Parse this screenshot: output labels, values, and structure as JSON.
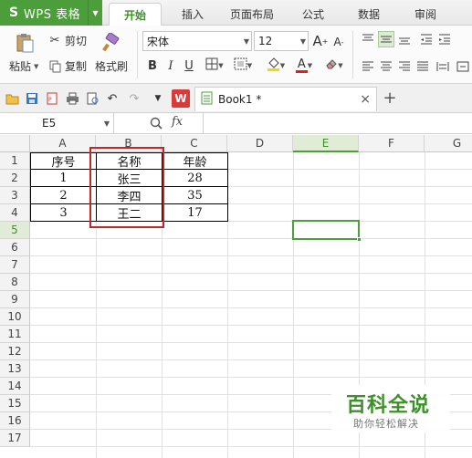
{
  "app": {
    "title": "WPS 表格",
    "logo": "S"
  },
  "tabs": [
    "开始",
    "插入",
    "页面布局",
    "公式",
    "数据",
    "审阅"
  ],
  "active_tab": "开始",
  "ribbon": {
    "paste": "粘贴",
    "cut": "剪切",
    "copy": "复制",
    "format_painter": "格式刷",
    "font_name": "宋体",
    "font_size": "12",
    "bold": "B",
    "italic": "I",
    "underline": "U",
    "font_color_letter": "A",
    "grow_font": "A",
    "shrink_font": "A"
  },
  "document_tab": {
    "title": "Book1 *",
    "close": "×",
    "new_tab": "+"
  },
  "formula_bar": {
    "name_box": "E5",
    "fx": "fx"
  },
  "columns": [
    "A",
    "B",
    "C",
    "D",
    "E",
    "F",
    "G"
  ],
  "rows": [
    "1",
    "2",
    "3",
    "4",
    "5",
    "6",
    "7",
    "8",
    "9",
    "10",
    "11",
    "12",
    "13",
    "14",
    "15",
    "16",
    "17"
  ],
  "selected_cell": "E5",
  "cells": {
    "a1": "序号",
    "b1": "名称",
    "c1": "年龄",
    "a2": "1",
    "b2": "张三",
    "c2": "28",
    "a3": "2",
    "b3": "李四",
    "c3": "35",
    "a4": "3",
    "b4": "王二",
    "c4": "17"
  },
  "watermark": {
    "title": "百科全说",
    "subtitle": "助你轻松解决"
  },
  "colors": {
    "accent": "#4b9e3a",
    "highlight_box": "#c0262c"
  }
}
